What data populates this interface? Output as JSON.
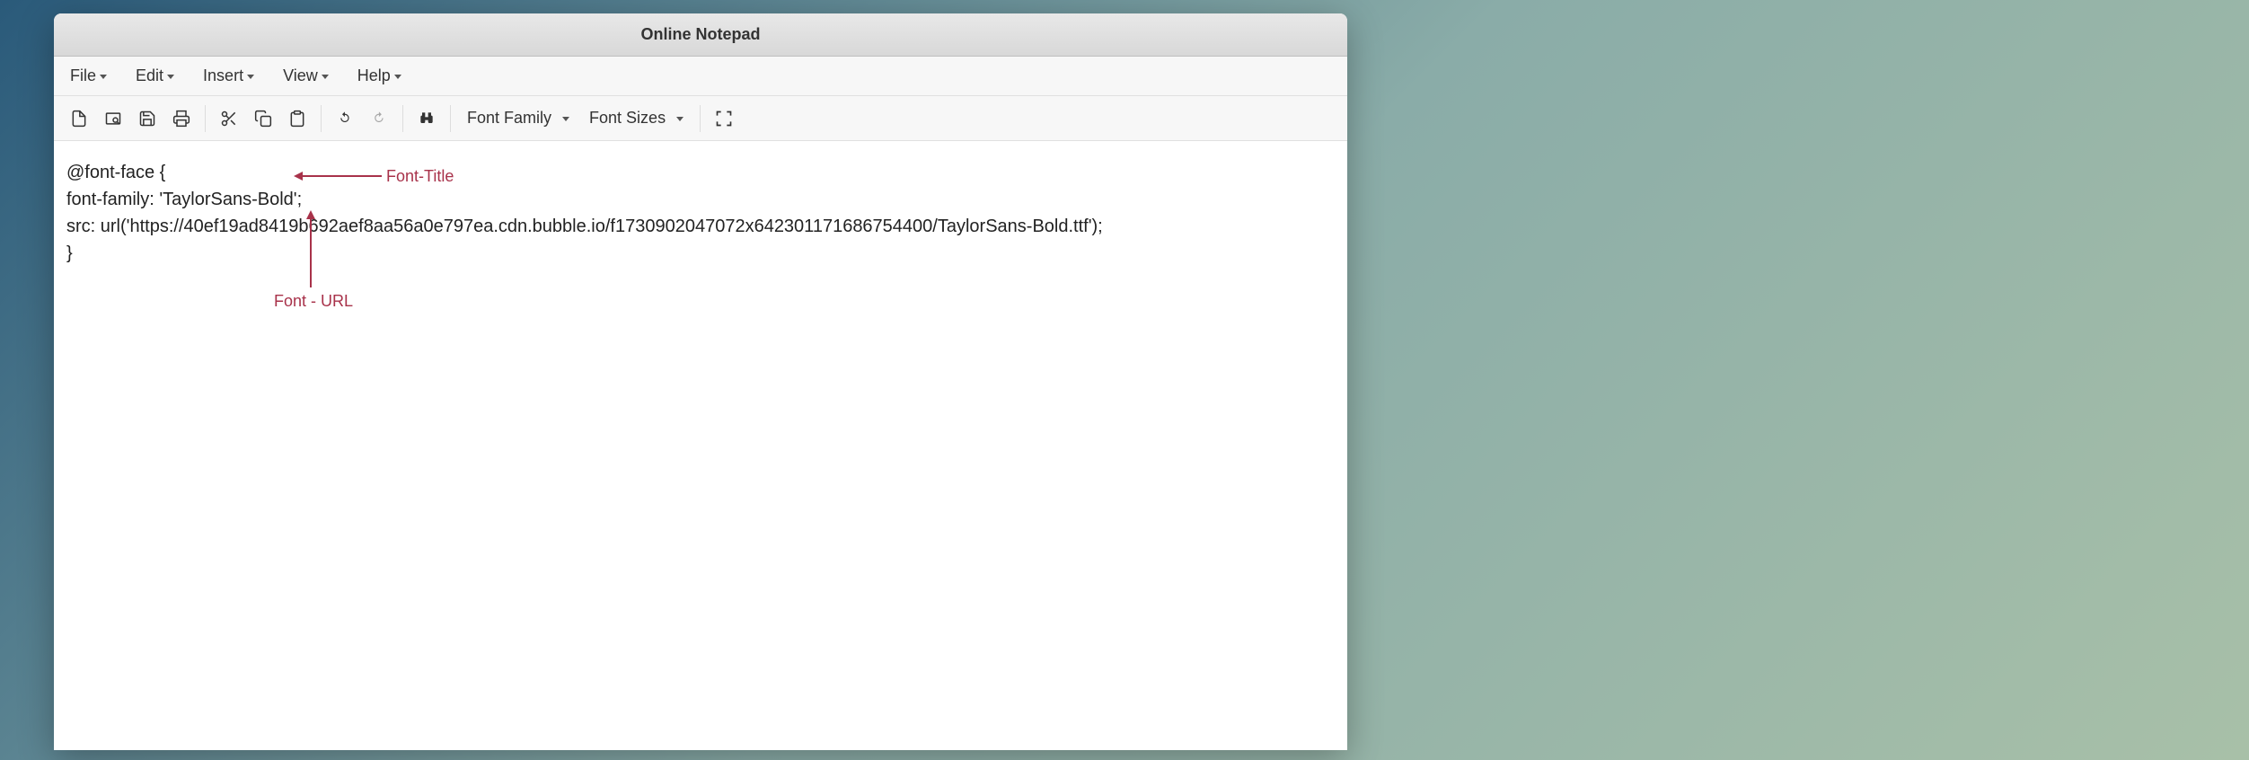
{
  "window": {
    "title": "Online Notepad"
  },
  "menubar": {
    "items": [
      {
        "label": "File"
      },
      {
        "label": "Edit"
      },
      {
        "label": "Insert"
      },
      {
        "label": "View"
      },
      {
        "label": "Help"
      }
    ]
  },
  "toolbar": {
    "font_family_label": "Font Family",
    "font_sizes_label": "Font Sizes"
  },
  "editor": {
    "line1": "@font-face {",
    "line2": "font-family: 'TaylorSans-Bold';",
    "line3": "src: url('https://40ef19ad8419b692aef8aa56a0e797ea.cdn.bubble.io/f1730902047072x642301171686754400/TaylorSans-Bold.ttf');",
    "line4": "}"
  },
  "annotations": {
    "font_title": "Font-Title",
    "font_url": "Font - URL"
  }
}
